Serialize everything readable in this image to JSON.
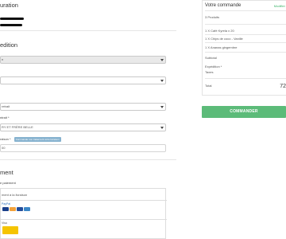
{
  "left": {
    "section1_title": "uration",
    "section2_title": "edition",
    "shipping_select_1": "n",
    "shipping_select_2": "",
    "label_1": "",
    "select_value_3": "retrait",
    "label_2": "ntrait *",
    "select_value_4": "RY ET FRÈRE BELLE",
    "label_3": "raison *",
    "pill_text": "Commande non traitement votre livraison",
    "input_value": "00",
    "section3_title": "ment",
    "payment_label": "e paiement",
    "payment_option_1": "ment à la livraison",
    "payment_option_2": "PayPal",
    "payment_option_3": "Visa"
  },
  "order": {
    "title": "Votre commande",
    "modify": "Modifier",
    "product_count": "3 Produits",
    "items": [
      "1 X Café Kyrela x 20",
      "1 X Chips de coco - Vanille",
      "1 X Ananas gingembre"
    ],
    "subtotal_label": "Subtotal",
    "shipping_label": "Expédition *",
    "taxes_label": "Taxes",
    "total_label": "Total",
    "total_value": "72",
    "cta_label": "COMMANDER"
  },
  "colors": {
    "accent_green": "#5cbb79",
    "pill_blue": "#86b2cf"
  }
}
